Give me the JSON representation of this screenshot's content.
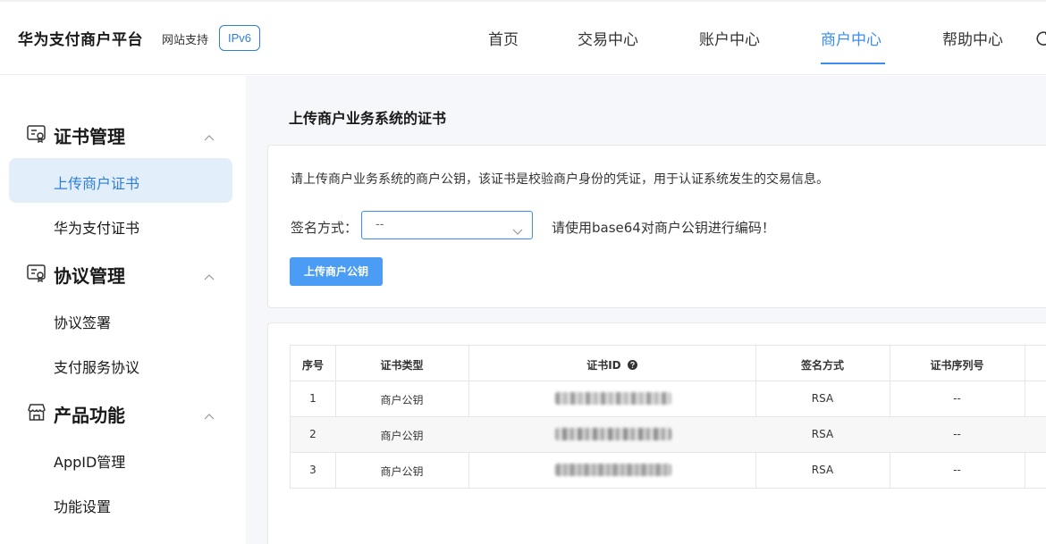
{
  "header": {
    "brand": "华为支付商户平台",
    "support_label": "网站支持",
    "ipv6_badge": "IPv6",
    "nav": [
      {
        "label": "首页",
        "active": false
      },
      {
        "label": "交易中心",
        "active": false
      },
      {
        "label": "账户中心",
        "active": false
      },
      {
        "label": "商户中心",
        "active": true
      },
      {
        "label": "帮助中心",
        "active": false
      }
    ],
    "accent_color": "#3b8ef0"
  },
  "sidebar": {
    "sections": [
      {
        "title": "证书管理",
        "icon": "certificate-icon",
        "expanded": true,
        "items": [
          {
            "label": "上传商户证书",
            "active": true
          },
          {
            "label": "华为支付证书",
            "active": false
          }
        ]
      },
      {
        "title": "协议管理",
        "icon": "certificate-icon",
        "expanded": true,
        "items": [
          {
            "label": "协议签署",
            "active": false
          },
          {
            "label": "支付服务协议",
            "active": false
          }
        ]
      },
      {
        "title": "产品功能",
        "icon": "store-icon",
        "expanded": true,
        "items": [
          {
            "label": "AppID管理",
            "active": false
          },
          {
            "label": "功能设置",
            "active": false
          }
        ]
      }
    ]
  },
  "main": {
    "page_title": "上传商户业务系统的证书",
    "description": "请上传商户业务系统的商户公钥，该证书是校验商户身份的凭证，用于认证系统发生的交易信息。",
    "sign_method_label": "签名方式：",
    "sign_method_value": "--",
    "hint": "请使用base64对商户公钥进行编码！",
    "upload_button": "上传商户公钥"
  },
  "table": {
    "columns": [
      "序号",
      "证书类型",
      "证书ID",
      "签名方式",
      "证书序列号"
    ],
    "rows": [
      {
        "index": "1",
        "type": "商户公钥",
        "cert_id": "",
        "sign": "RSA",
        "serial": "--"
      },
      {
        "index": "2",
        "type": "商户公钥",
        "cert_id": "",
        "sign": "RSA",
        "serial": "--"
      },
      {
        "index": "3",
        "type": "商户公钥",
        "cert_id": "",
        "sign": "RSA",
        "serial": "--"
      }
    ]
  }
}
